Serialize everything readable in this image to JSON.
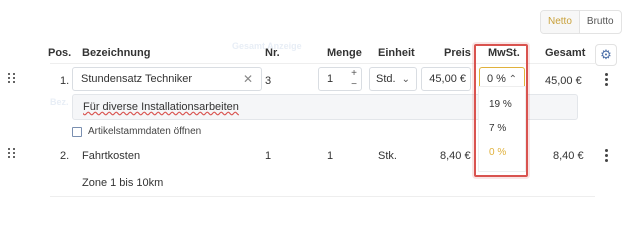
{
  "toggle": {
    "netto": "Netto",
    "brutto": "Brutto"
  },
  "header": {
    "pos": "Pos.",
    "bezeichnung": "Bezeichnung",
    "nr": "Nr.",
    "menge": "Menge",
    "einheit": "Einheit",
    "preis": "Preis",
    "mwst": "MwSt.",
    "gesamt": "Gesamt",
    "ghost_text": "Gesamt Anzeige"
  },
  "row1": {
    "pos": "1.",
    "bezeichnung": "Stundensatz Techniker",
    "nr": "3",
    "menge": "1",
    "einheit": "Std.",
    "preis": "45,00 €",
    "mwst": "0 %",
    "gesamt": "45,00 €",
    "beschreibung": "Für diverse Installationsarbeiten",
    "artikel_link": "Artikelstammdaten öffnen",
    "ghost": "Bez."
  },
  "row2": {
    "pos": "2.",
    "bezeichnung": "Fahrtkosten",
    "nr": "1",
    "menge": "1",
    "einheit": "Stk.",
    "preis": "8,40 €",
    "mwst": "0 %",
    "gesamt": "8,40 €",
    "beschreibung": "Zone 1 bis 10km"
  },
  "mwst_options": [
    "19 %",
    "7 %",
    "0 %"
  ],
  "colors": {
    "accent": "#e0b13c",
    "highlight": "#d9534f",
    "gear": "#4c6fa8"
  }
}
